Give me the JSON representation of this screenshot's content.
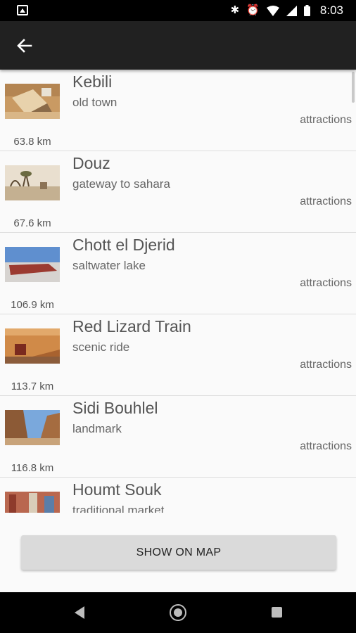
{
  "status_bar": {
    "time": "8:03",
    "icons": [
      "image-notification-icon",
      "bluetooth-icon",
      "alarm-icon",
      "wifi-icon",
      "signal-icon",
      "battery-icon"
    ]
  },
  "app_bar": {
    "back_icon": "arrow-left-icon"
  },
  "items": [
    {
      "title": "Kebili",
      "subtitle": "old town",
      "category": "attractions",
      "distance": "63.8 km"
    },
    {
      "title": "Douz",
      "subtitle": "gateway to sahara",
      "category": "attractions",
      "distance": "67.6 km"
    },
    {
      "title": "Chott el Djerid",
      "subtitle": "saltwater lake",
      "category": "attractions",
      "distance": "106.9 km"
    },
    {
      "title": "Red Lizard Train",
      "subtitle": "scenic ride",
      "category": "attractions",
      "distance": "113.7 km"
    },
    {
      "title": "Sidi Bouhlel",
      "subtitle": "landmark",
      "category": "attractions",
      "distance": "116.8 km"
    },
    {
      "title": "Houmt Souk",
      "subtitle": "traditional market",
      "category": "",
      "distance": ""
    }
  ],
  "show_on_map_label": "SHOW ON MAP",
  "colors": {
    "app_bar": "#212121",
    "status_bar": "#000000",
    "background": "#fafafa",
    "button": "#dadada"
  }
}
